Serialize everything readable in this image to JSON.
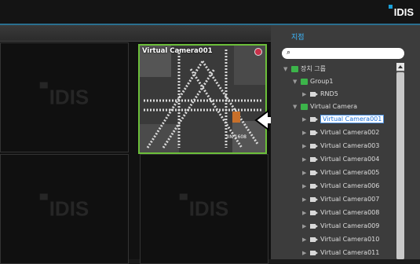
{
  "brand": {
    "logo_text": "IDIS"
  },
  "panel": {
    "title": "지점",
    "search_icon": "search-icon",
    "tree": {
      "device_group": "장치 그룹",
      "group1": "Group1",
      "rnd5": "RND5",
      "virtual_camera": "Virtual Camera",
      "cameras": [
        "Virtual Camera001",
        "Virtual Camera002",
        "Virtual Camera003",
        "Virtual Camera004",
        "Virtual Camera005",
        "Virtual Camera006",
        "Virtual Camera007",
        "Virtual Camera008",
        "Virtual Camera009",
        "Virtual Camera010",
        "Virtual Camera011"
      ],
      "selected_index": 0
    }
  },
  "grid": {
    "watermark": "IDIS",
    "active_camera": {
      "title": "Virtual Camera001",
      "stamp": "IIN 1608"
    }
  },
  "colors": {
    "accent": "#3db8ff",
    "selection_border": "#6cbf3a",
    "record": "#c8314a"
  }
}
